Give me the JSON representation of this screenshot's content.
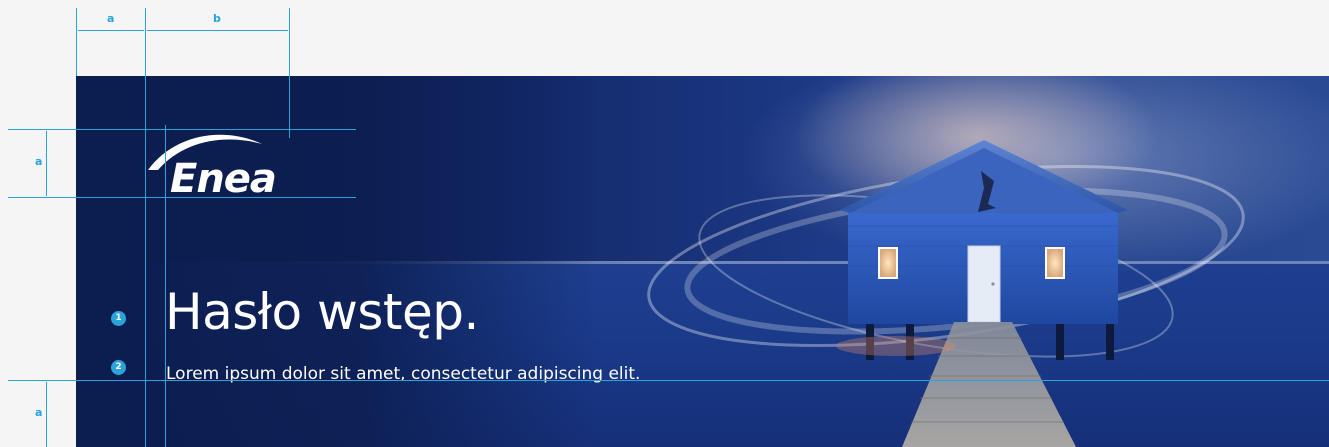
{
  "logo": {
    "text": "Enea"
  },
  "headline": "Hasło wstęp.",
  "subheadline": "Lorem ipsum dolor sit amet, consectetur adipiscing elit.",
  "dimensions": {
    "top_a": "a",
    "top_b": "b",
    "left_a_top": "a",
    "left_a_bottom": "a"
  },
  "markers": {
    "m1": "1",
    "m2": "2"
  },
  "colors": {
    "guide": "#29a3d9",
    "banner_dark": "#0c1d4f",
    "house_blue": "#2a58b8",
    "text": "#ffffff"
  }
}
